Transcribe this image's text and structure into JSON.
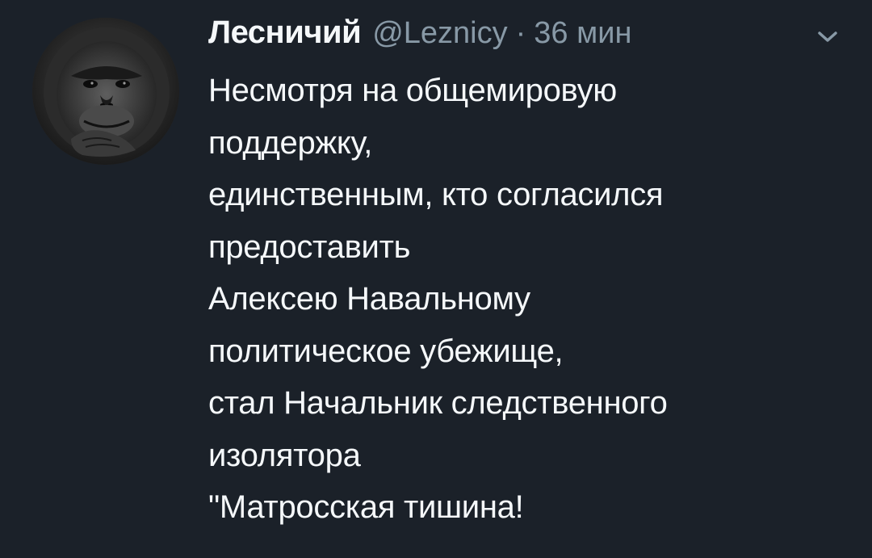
{
  "tweet": {
    "author_name": "Лесничий",
    "handle": "@Leznicy",
    "separator": "·",
    "time": "36 мин",
    "lines": [
      "Несмотря на общемировую",
      "поддержку,",
      "единственным, кто согласился",
      "предоставить",
      "Алексею Навальному",
      "политическое убежище,",
      "стал Начальник следственного",
      "изолятора",
      "\"Матросская тишина!"
    ]
  },
  "icons": {
    "avatar": "monkey-avatar",
    "menu": "chevron-down-icon"
  },
  "colors": {
    "background": "#1b2129",
    "text_primary": "#f5f8fa",
    "text_secondary": "#8899a6"
  }
}
